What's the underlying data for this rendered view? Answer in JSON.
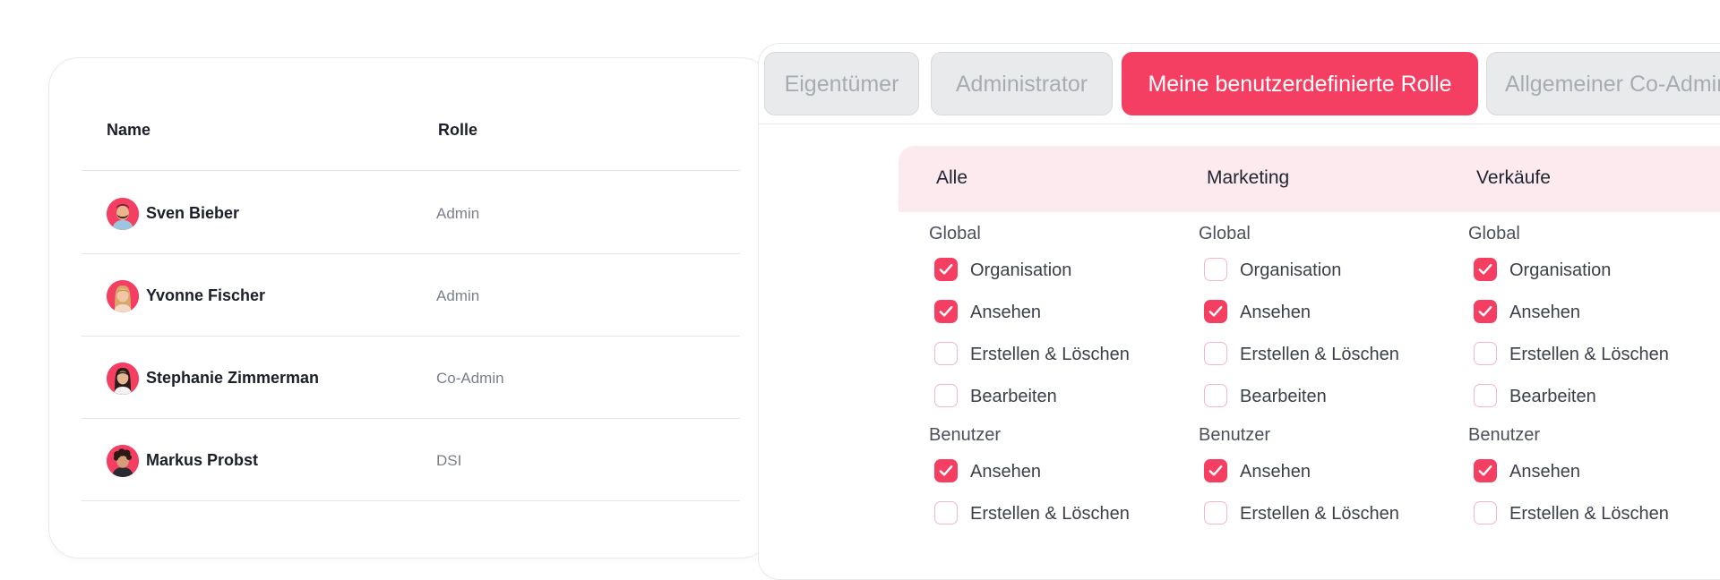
{
  "users_table": {
    "columns": {
      "name": "Name",
      "role": "Rolle"
    },
    "rows": [
      {
        "name": "Sven Bieber",
        "role": "Admin",
        "avatar": "avatar-man-beard"
      },
      {
        "name": "Yvonne Fischer",
        "role": "Admin",
        "avatar": "avatar-woman-blonde"
      },
      {
        "name": "Stephanie Zimmerman",
        "role": "Co-Admin",
        "avatar": "avatar-woman-dark-hair"
      },
      {
        "name": "Markus Probst",
        "role": "DSI",
        "avatar": "avatar-man-curly"
      }
    ]
  },
  "role_tabs": [
    {
      "label": "Eigentümer",
      "active": false
    },
    {
      "label": "Administrator",
      "active": false
    },
    {
      "label": "Meine benutzerdefinierte Rolle",
      "active": true
    },
    {
      "label": "Allgemeiner Co-Admin",
      "active": false
    }
  ],
  "permissions": {
    "columns": [
      {
        "title": "Alle",
        "groups": [
          {
            "label": "Global",
            "items": [
              {
                "label": "Organisation",
                "checked": true
              },
              {
                "label": "Ansehen",
                "checked": true
              },
              {
                "label": "Erstellen & Löschen",
                "checked": false
              },
              {
                "label": "Bearbeiten",
                "checked": false
              }
            ]
          },
          {
            "label": "Benutzer",
            "items": [
              {
                "label": "Ansehen",
                "checked": true
              },
              {
                "label": "Erstellen & Löschen",
                "checked": false
              }
            ]
          }
        ]
      },
      {
        "title": "Marketing",
        "groups": [
          {
            "label": "Global",
            "items": [
              {
                "label": "Organisation",
                "checked": false
              },
              {
                "label": "Ansehen",
                "checked": true
              },
              {
                "label": "Erstellen & Löschen",
                "checked": false
              },
              {
                "label": "Bearbeiten",
                "checked": false
              }
            ]
          },
          {
            "label": "Benutzer",
            "items": [
              {
                "label": "Ansehen",
                "checked": true
              },
              {
                "label": "Erstellen & Löschen",
                "checked": false
              }
            ]
          }
        ]
      },
      {
        "title": "Verkäufe",
        "groups": [
          {
            "label": "Global",
            "items": [
              {
                "label": "Organisation",
                "checked": true
              },
              {
                "label": "Ansehen",
                "checked": true
              },
              {
                "label": "Erstellen & Löschen",
                "checked": false
              },
              {
                "label": "Bearbeiten",
                "checked": false
              }
            ]
          },
          {
            "label": "Benutzer",
            "items": [
              {
                "label": "Ansehen",
                "checked": true
              },
              {
                "label": "Erstellen & Löschen",
                "checked": false
              }
            ]
          }
        ]
      }
    ]
  },
  "colors": {
    "accent": "#f43f63",
    "accent_soft": "#fdeaee",
    "checkbox_border": "#f3b7c3",
    "tab_inactive_bg": "#e9eaec",
    "tab_inactive_text": "#a7abb3"
  }
}
